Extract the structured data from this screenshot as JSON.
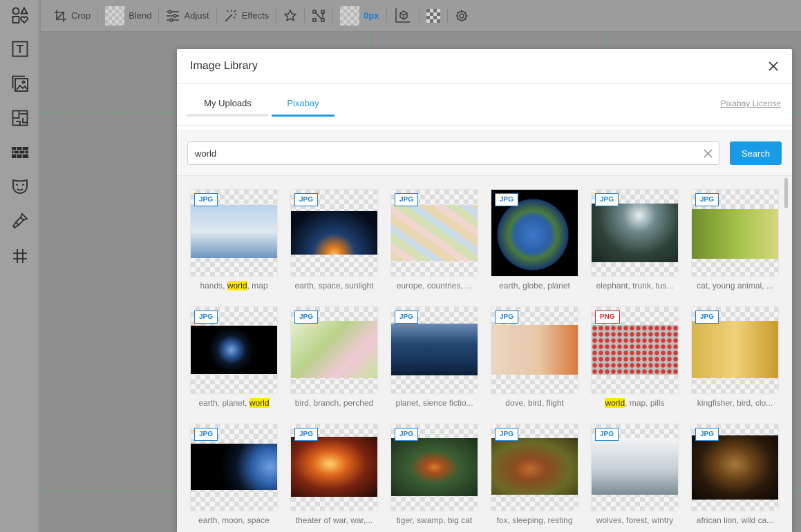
{
  "toolbar": {
    "crop_label": "Crop",
    "blend_label": "Blend",
    "adjust_label": "Adjust",
    "effects_label": "Effects",
    "padding_value": "0px"
  },
  "modal": {
    "title": "Image Library",
    "tabs": [
      {
        "label": "My Uploads",
        "active": false
      },
      {
        "label": "Pixabay",
        "active": true
      }
    ],
    "license_label": "Pixabay License",
    "search": {
      "value": "world",
      "button_label": "Search"
    }
  },
  "colors": {
    "accent": "#1a9be8",
    "highlight": "#ffeb00"
  },
  "images": [
    {
      "type": "JPG",
      "caption": [
        "hands, ",
        "world",
        ", map"
      ],
      "hl": 1
    },
    {
      "type": "JPG",
      "caption": [
        "earth, space, sunlight"
      ]
    },
    {
      "type": "JPG",
      "caption": [
        "europe, countries, ..."
      ]
    },
    {
      "type": "JPG",
      "caption": [
        "earth, globe, planet"
      ]
    },
    {
      "type": "JPG",
      "caption": [
        "elephant, trunk, tus..."
      ]
    },
    {
      "type": "JPG",
      "caption": [
        "cat, young animal, ..."
      ]
    },
    {
      "type": "JPG",
      "caption": [
        "earth, planet, ",
        "world"
      ],
      "hl": 1
    },
    {
      "type": "JPG",
      "caption": [
        "bird, branch, perched"
      ]
    },
    {
      "type": "JPG",
      "caption": [
        "planet, sience fictio..."
      ]
    },
    {
      "type": "JPG",
      "caption": [
        "dove, bird, flight"
      ]
    },
    {
      "type": "PNG",
      "caption": [
        "world",
        ", map, pills"
      ],
      "hl": 0
    },
    {
      "type": "JPG",
      "caption": [
        "kingfisher, bird, clo..."
      ]
    },
    {
      "type": "JPG",
      "caption": [
        "earth, moon, space"
      ]
    },
    {
      "type": "JPG",
      "caption": [
        "theater of war, war,..."
      ]
    },
    {
      "type": "JPG",
      "caption": [
        "tiger, swamp, big cat"
      ]
    },
    {
      "type": "JPG",
      "caption": [
        "fox, sleeping, resting"
      ]
    },
    {
      "type": "JPG",
      "caption": [
        "wolves, forest, wintry"
      ]
    },
    {
      "type": "JPG",
      "caption": [
        "african lion, wild ca..."
      ]
    }
  ]
}
